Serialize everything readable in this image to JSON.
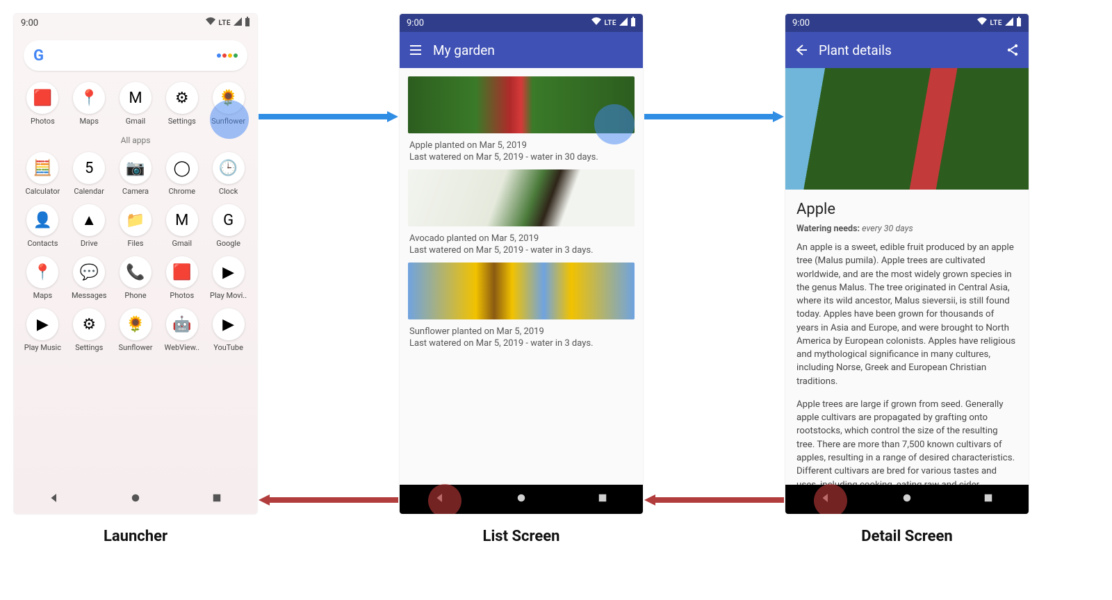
{
  "status": {
    "time": "9:00",
    "lte": "LTE"
  },
  "captions": {
    "launcher": "Launcher",
    "list": "List Screen",
    "detail": "Detail Screen"
  },
  "launcher": {
    "all_apps_label": "All apps",
    "favorites": [
      {
        "name": "Photos",
        "glyph": "🟥"
      },
      {
        "name": "Maps",
        "glyph": "📍"
      },
      {
        "name": "Gmail",
        "glyph": "M"
      },
      {
        "name": "Settings",
        "glyph": "⚙"
      },
      {
        "name": "Sunflower",
        "glyph": "🌻"
      }
    ],
    "grid": [
      [
        {
          "name": "Calculator",
          "glyph": "🧮"
        },
        {
          "name": "Calendar",
          "glyph": "5"
        },
        {
          "name": "Camera",
          "glyph": "📷"
        },
        {
          "name": "Chrome",
          "glyph": "◯"
        },
        {
          "name": "Clock",
          "glyph": "🕒"
        }
      ],
      [
        {
          "name": "Contacts",
          "glyph": "👤"
        },
        {
          "name": "Drive",
          "glyph": "▲"
        },
        {
          "name": "Files",
          "glyph": "📁"
        },
        {
          "name": "Gmail",
          "glyph": "M"
        },
        {
          "name": "Google",
          "glyph": "G"
        }
      ],
      [
        {
          "name": "Maps",
          "glyph": "📍"
        },
        {
          "name": "Messages",
          "glyph": "💬"
        },
        {
          "name": "Phone",
          "glyph": "📞"
        },
        {
          "name": "Photos",
          "glyph": "🟥"
        },
        {
          "name": "Play Movi..",
          "glyph": "▶"
        }
      ],
      [
        {
          "name": "Play Music",
          "glyph": "▶"
        },
        {
          "name": "Settings",
          "glyph": "⚙"
        },
        {
          "name": "Sunflower",
          "glyph": "🌻"
        },
        {
          "name": "WebView..",
          "glyph": "🤖"
        },
        {
          "name": "YouTube",
          "glyph": "▶"
        }
      ]
    ]
  },
  "list": {
    "title": "My garden",
    "items": [
      {
        "image": "apple",
        "line1": "Apple planted on Mar 5, 2019",
        "line2": "Last watered on Mar 5, 2019 - water in 30 days."
      },
      {
        "image": "avocado",
        "line1": "Avocado planted on Mar 5, 2019",
        "line2": "Last watered on Mar 5, 2019 - water in 3 days."
      },
      {
        "image": "sunflower",
        "line1": "Sunflower planted on Mar 5, 2019",
        "line2": "Last watered on Mar 5, 2019 - water in 3 days."
      }
    ]
  },
  "detail": {
    "title": "Plant details",
    "plant_name": "Apple",
    "watering_label": "Watering needs:",
    "watering_value": "every 30 days",
    "para1": "An apple is a sweet, edible fruit produced by an apple tree (Malus pumila). Apple trees are cultivated worldwide, and are the most widely grown species in the genus Malus. The tree originated in Central Asia, where its wild ancestor, Malus sieversii, is still found today. Apples have been grown for thousands of years in Asia and Europe, and were brought to North America by European colonists. Apples have religious and mythological significance in many cultures, including Norse, Greek and European Christian traditions.",
    "para2": "Apple trees are large if grown from seed. Generally apple cultivars are propagated by grafting onto rootstocks, which control the size of the resulting tree. There are more than 7,500 known cultivars of apples, resulting in a range of desired characteristics. Different cultivars are bred for various tastes and uses, including cooking, eating raw and cider production. Trees and fruit"
  }
}
